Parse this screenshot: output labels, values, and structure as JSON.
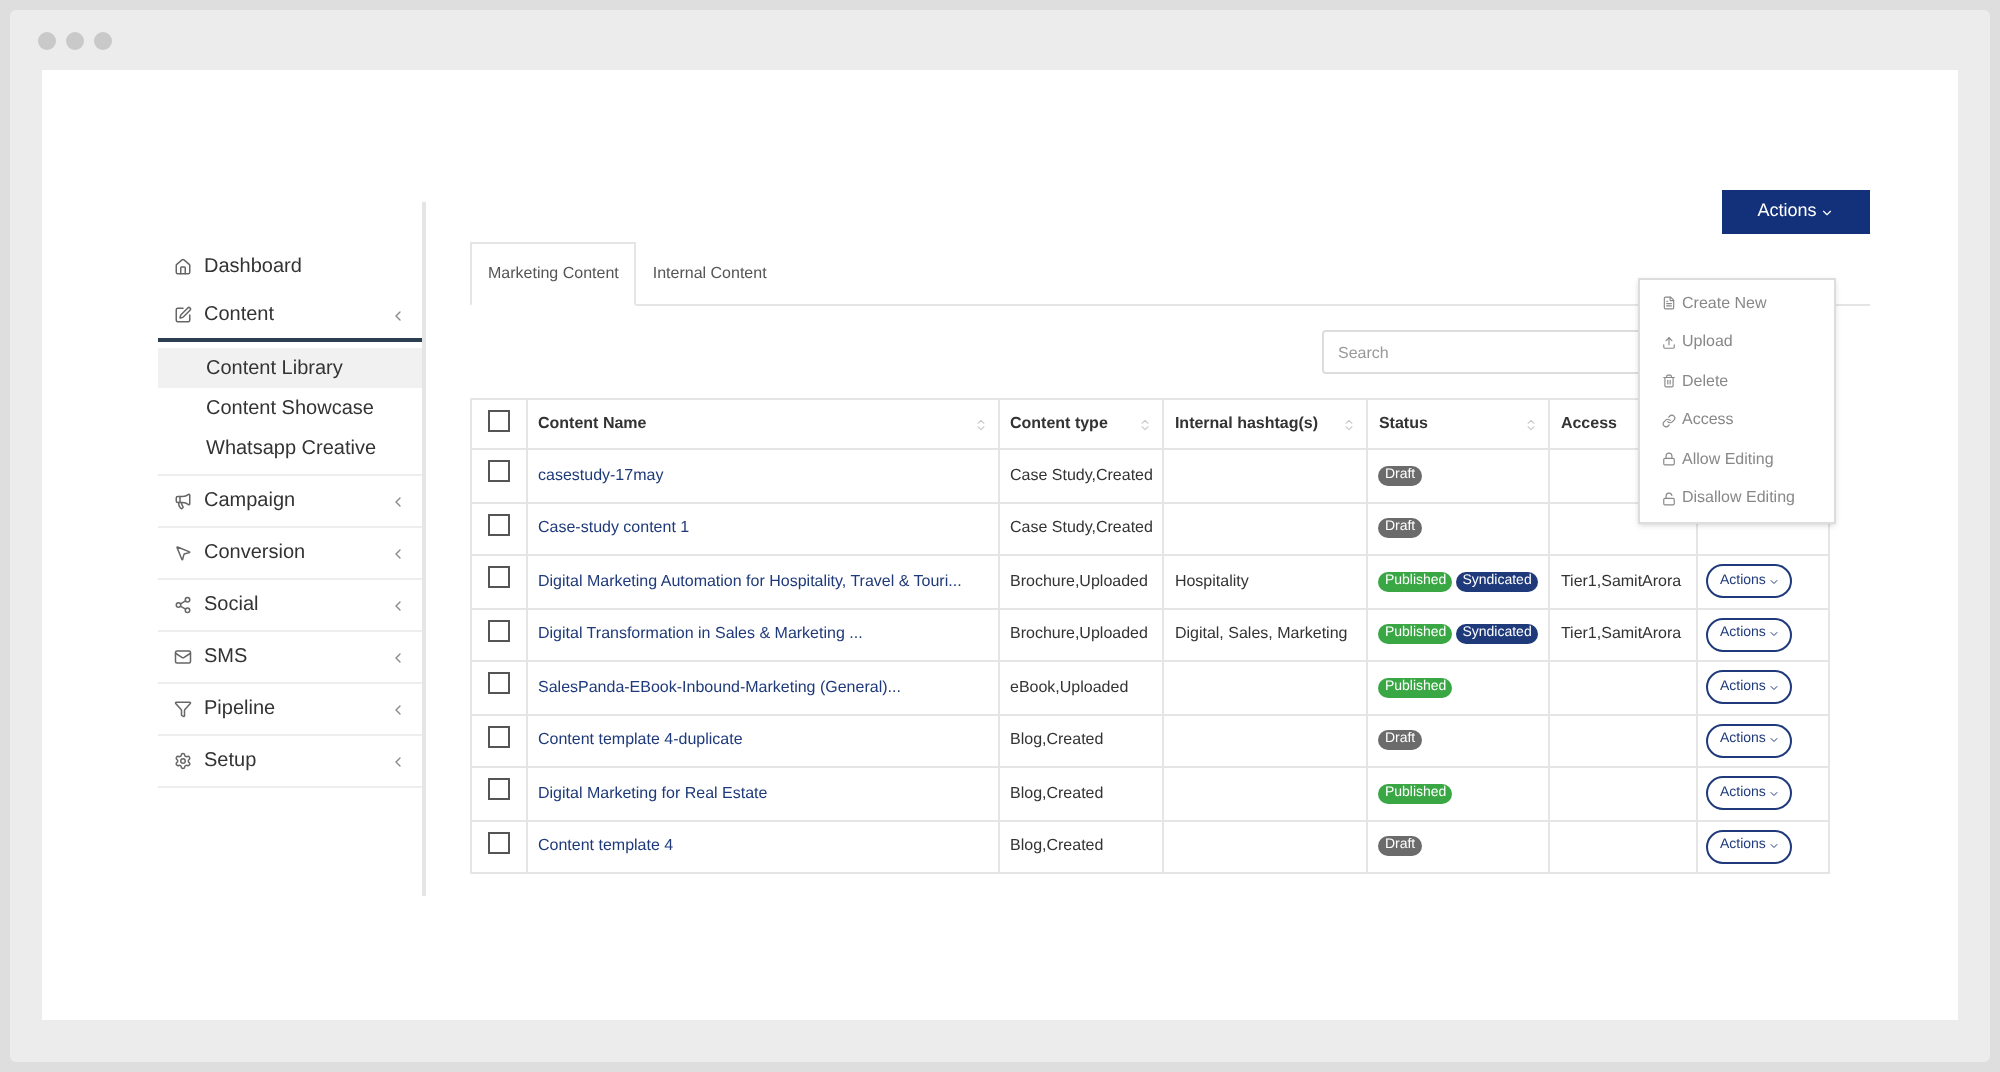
{
  "sidebar": {
    "items": [
      {
        "label": "Dashboard",
        "kind": "link",
        "expanded": false
      },
      {
        "label": "Content",
        "kind": "group",
        "expanded": true,
        "children": [
          {
            "label": "Content Library",
            "selected": true
          },
          {
            "label": "Content Showcase",
            "selected": false
          },
          {
            "label": "Whatsapp Creative",
            "selected": false
          }
        ]
      },
      {
        "label": "Campaign",
        "kind": "group",
        "expanded": false
      },
      {
        "label": "Conversion",
        "kind": "group",
        "expanded": false
      },
      {
        "label": "Social",
        "kind": "group",
        "expanded": false
      },
      {
        "label": "SMS",
        "kind": "group",
        "expanded": false
      },
      {
        "label": "Pipeline",
        "kind": "group",
        "expanded": false
      },
      {
        "label": "Setup",
        "kind": "group",
        "expanded": false
      }
    ]
  },
  "actions_button": "Actions",
  "actions_menu": [
    {
      "label": "Create New"
    },
    {
      "label": "Upload"
    },
    {
      "label": "Delete"
    },
    {
      "label": "Access"
    },
    {
      "label": "Allow Editing"
    },
    {
      "label": "Disallow Editing"
    }
  ],
  "tabs": [
    {
      "label": "Marketing Content",
      "selected": true
    },
    {
      "label": "Internal Content",
      "selected": false
    }
  ],
  "search": {
    "placeholder": "Search"
  },
  "table": {
    "select_all_checked": false,
    "columns": [
      "Content Name",
      "Content type",
      "Internal hashtag(s)",
      "Status",
      "Access"
    ],
    "rows": [
      {
        "checked": false,
        "name": "casestudy-17may",
        "type": "Case Study,Created",
        "hashtags": "",
        "status": [
          {
            "label": "Draft",
            "kind": "draft"
          }
        ],
        "access": ""
      },
      {
        "checked": false,
        "name": "Case-study content 1",
        "type": "Case Study,Created",
        "hashtags": "",
        "status": [
          {
            "label": "Draft",
            "kind": "draft"
          }
        ],
        "access": ""
      },
      {
        "checked": false,
        "name": "Digital Marketing Automation for Hospitality, Travel & Touri...",
        "type": "Brochure,Uploaded",
        "hashtags": "Hospitality",
        "status": [
          {
            "label": "Published",
            "kind": "published"
          },
          {
            "label": "Syndicated",
            "kind": "syndicated"
          }
        ],
        "access": "Tier1,SamitArora",
        "action": "Actions"
      },
      {
        "checked": false,
        "name": "Digital Transformation in Sales & Marketing ...",
        "type": "Brochure,Uploaded",
        "hashtags": "Digital, Sales, Marketing",
        "status": [
          {
            "label": "Published",
            "kind": "published"
          },
          {
            "label": "Syndicated",
            "kind": "syndicated"
          }
        ],
        "access": "Tier1,SamitArora",
        "action": "Actions"
      },
      {
        "checked": false,
        "name": "SalesPanda-EBook-Inbound-Marketing (General)...",
        "type": "eBook,Uploaded",
        "hashtags": "",
        "status": [
          {
            "label": "Published",
            "kind": "published"
          }
        ],
        "access": "",
        "action": "Actions"
      },
      {
        "checked": false,
        "name": "Content template 4-duplicate",
        "type": "Blog,Created",
        "hashtags": "",
        "status": [
          {
            "label": "Draft",
            "kind": "draft"
          }
        ],
        "access": "",
        "action": "Actions"
      },
      {
        "checked": false,
        "name": "Digital Marketing for Real Estate",
        "type": "Blog,Created",
        "hashtags": "",
        "status": [
          {
            "label": "Published",
            "kind": "published"
          }
        ],
        "access": "",
        "action": "Actions"
      },
      {
        "checked": false,
        "name": "Content template 4",
        "type": "Blog,Created",
        "hashtags": "",
        "status": [
          {
            "label": "Draft",
            "kind": "draft"
          }
        ],
        "access": "",
        "action": "Actions"
      }
    ]
  }
}
